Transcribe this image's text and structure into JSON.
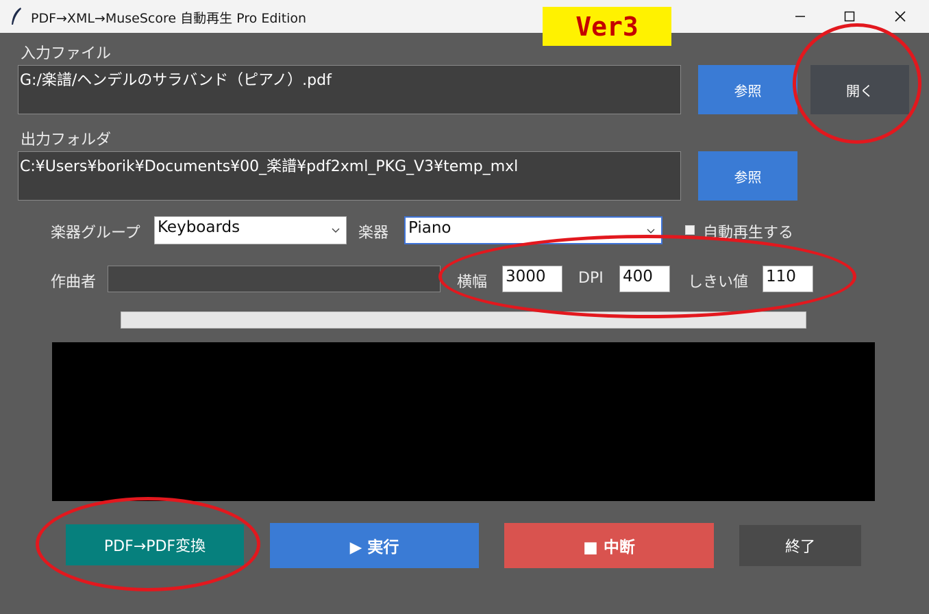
{
  "window": {
    "title": "PDF→XML→MuseScore 自動再生 Pro Edition",
    "controls": [
      "minimize-icon",
      "maximize-icon",
      "close-icon"
    ]
  },
  "badge": {
    "text": "Ver3",
    "background": "#fff200",
    "color": "#c40000"
  },
  "input_file": {
    "label": "入力ファイル",
    "value": "G:/楽譜/ヘンデルのサラバンド（ピアノ）.pdf",
    "browse_label": "参照",
    "open_label": "開く"
  },
  "output_folder": {
    "label": "出力フォルダ",
    "value": "C:¥Users¥borik¥Documents¥00_楽譜¥pdf2xml_PKG_V3¥temp_mxl",
    "browse_label": "参照"
  },
  "options": {
    "instrument_group_label": "楽器グループ",
    "instrument_group_value": "Keyboards",
    "instrument_label": "楽器",
    "instrument_value": "Piano",
    "autoplay_label": "自動再生する",
    "autoplay_checked": false
  },
  "params": {
    "composer_label": "作曲者",
    "composer_value": "",
    "width_label": "横幅",
    "width_value": "3000",
    "dpi_label": "DPI",
    "dpi_value": "400",
    "threshold_label": "しきい値",
    "threshold_value": "110"
  },
  "progress": {
    "value": 0
  },
  "log": {
    "text": ""
  },
  "actions": {
    "pdf_convert_label": "PDF→PDF変換",
    "run_label": "▶ 実行",
    "stop_label": "■ 中断",
    "exit_label": "終了"
  },
  "colors": {
    "background": "#5b5b5b",
    "accent_blue": "#3a7bd5",
    "teal": "#06807d",
    "stop_red": "#d9534f",
    "exit_gray": "#4a4a4a",
    "annotation_red": "#e2181e"
  }
}
